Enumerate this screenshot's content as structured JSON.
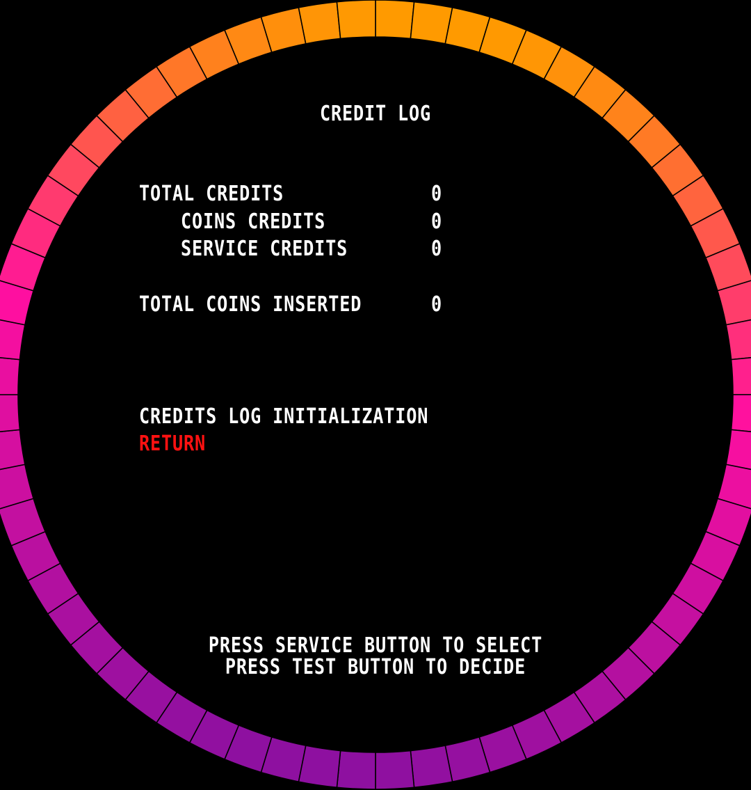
{
  "screen": {
    "title": "CREDIT LOG",
    "rows": [
      {
        "label": "TOTAL CREDITS",
        "value": "0"
      },
      {
        "label": "COINS CREDITS",
        "value": "0"
      },
      {
        "label": "SERVICE CREDITS",
        "value": "0"
      },
      {
        "label": "TOTAL COINS INSERTED",
        "value": "0"
      }
    ],
    "menu": [
      {
        "label": "CREDITS LOG INITIALIZATION"
      },
      {
        "label": "RETURN"
      }
    ],
    "selected_menu_index": 1,
    "instructions": [
      "PRESS SERVICE BUTTON TO SELECT",
      "PRESS TEST BUTTON TO DECIDE"
    ]
  },
  "colors": {
    "background": "#000000",
    "text": "#ffffff",
    "selected_text": "#ff1111",
    "ring_top": "#8e10a0",
    "ring_side": "#ff0fa0",
    "ring_bottom": "#ff9a00"
  }
}
